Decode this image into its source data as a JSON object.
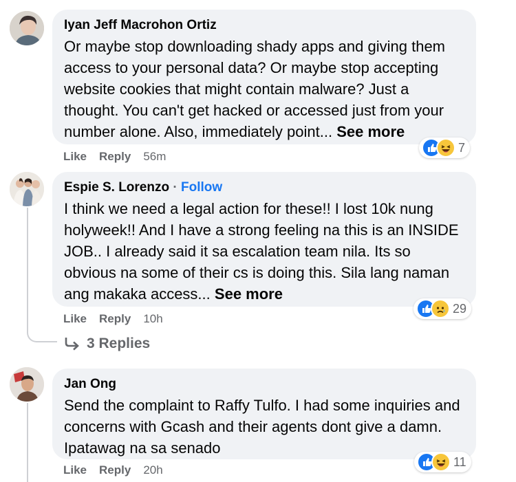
{
  "colors": {
    "bubble_bg": "#f0f2f5",
    "accent": "#1877f2",
    "muted_text": "#65676b",
    "text": "#050505"
  },
  "comments": [
    {
      "author": "Iyan Jeff Macrohon Ortiz",
      "text": "Or maybe stop downloading shady apps and giving them access to your personal data? Or maybe stop accepting website cookies that might contain malware? Just a thought. You can't get hacked or accessed just from your number alone. Also, immediately point...",
      "see_more": "See more",
      "like": "Like",
      "reply": "Reply",
      "time": "56m",
      "reactions": [
        "like-icon",
        "haha-icon"
      ],
      "reaction_count": "7"
    },
    {
      "author": "Espie S. Lorenzo",
      "separator": "·",
      "follow": "Follow",
      "text": "I think we need a legal action for these!! I lost 10k nung holyweek!! And I have a strong feeling na this is an INSIDE JOB.. I already said it sa escalation team nila. Its so obvious na some of their cs is doing this. Sila lang naman ang makaka access...",
      "see_more": "See more",
      "like": "Like",
      "reply": "Reply",
      "time": "10h",
      "reactions": [
        "like-icon",
        "sad-icon"
      ],
      "reaction_count": "29",
      "replies_label": "3 Replies",
      "replies_icon": "reply-arrow-icon"
    },
    {
      "author": "Jan Ong",
      "text": "Send the complaint to Raffy Tulfo. I had some inquiries and concerns with Gcash and their agents dont give a damn. Ipatawag na sa senado",
      "like": "Like",
      "reply": "Reply",
      "time": "20h",
      "reactions": [
        "like-icon",
        "haha-icon"
      ],
      "reaction_count": "11"
    }
  ]
}
